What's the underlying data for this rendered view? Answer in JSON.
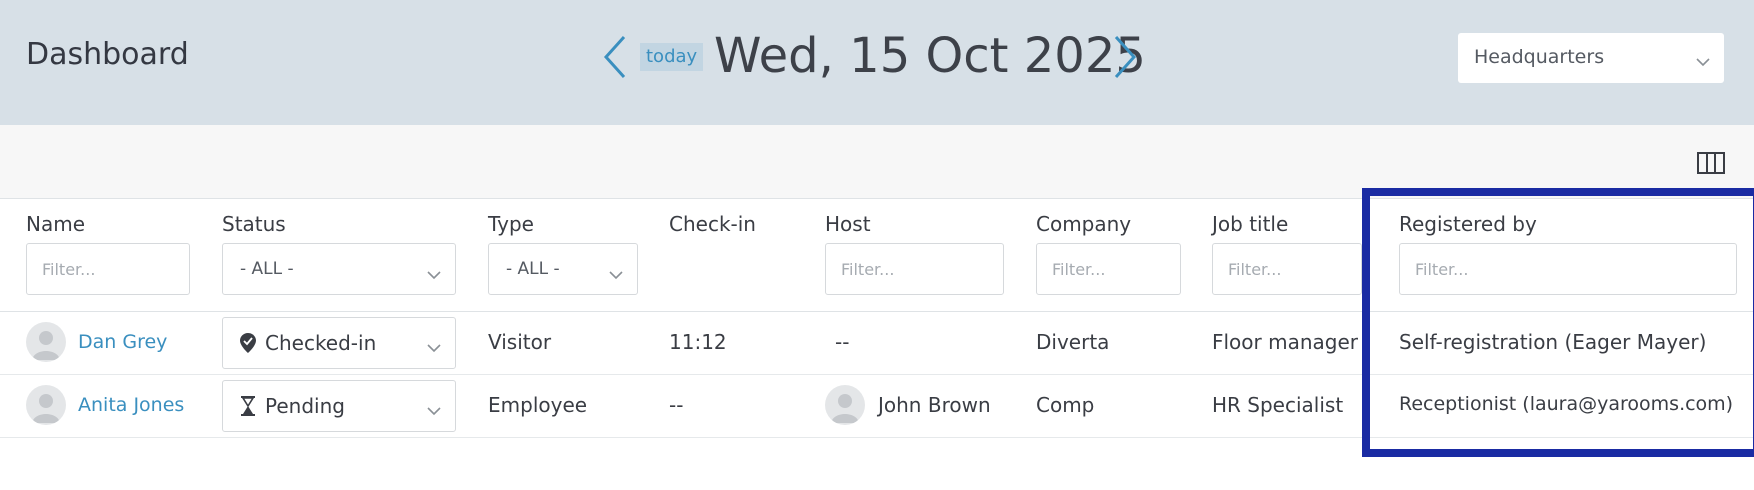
{
  "header": {
    "title": "Dashboard",
    "today_label": "today",
    "date": "Wed, 15 Oct 2025",
    "location": "Headquarters",
    "prev_icon": "chevron-left-icon",
    "next_icon": "chevron-right-icon"
  },
  "toolbar": {
    "columns_icon": "columns-icon"
  },
  "table": {
    "columns": [
      {
        "key": "name",
        "label": "Name",
        "filter": "input",
        "placeholder": "Filter..."
      },
      {
        "key": "status",
        "label": "Status",
        "filter": "select",
        "value": "- ALL -"
      },
      {
        "key": "type",
        "label": "Type",
        "filter": "select",
        "value": "- ALL -"
      },
      {
        "key": "checkin",
        "label": "Check-in",
        "filter": "none"
      },
      {
        "key": "host",
        "label": "Host",
        "filter": "input",
        "placeholder": "Filter..."
      },
      {
        "key": "company",
        "label": "Company",
        "filter": "input",
        "placeholder": "Filter..."
      },
      {
        "key": "job_title",
        "label": "Job title",
        "filter": "input",
        "placeholder": "Filter..."
      },
      {
        "key": "registered_by",
        "label": "Registered by",
        "filter": "input",
        "placeholder": "Filter..."
      }
    ],
    "rows": [
      {
        "name": "Dan Grey",
        "status": "Checked-in",
        "status_icon": "map-pin-icon",
        "type": "Visitor",
        "checkin": "11:12",
        "host": "--",
        "company": "Diverta",
        "job_title": "Floor manager",
        "registered_by": "Self-registration (Eager Mayer)"
      },
      {
        "name": "Anita Jones",
        "status": "Pending",
        "status_icon": "hourglass-icon",
        "type": "Employee",
        "checkin": "--",
        "host": "John Brown",
        "company": "Comp",
        "job_title": "HR Specialist",
        "registered_by": "Receptionist (laura@yarooms.com)"
      }
    ]
  },
  "colors": {
    "header_bg": "#d7e0e7",
    "accent": "#3a8fbf",
    "highlight": "#1a2ba3"
  }
}
